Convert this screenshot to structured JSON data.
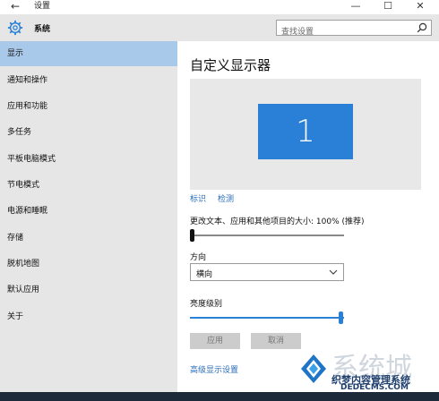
{
  "window": {
    "title": "设置",
    "back_icon": "arrow-left-icon",
    "controls": [
      "minimize-icon",
      "maximize-icon",
      "close-icon"
    ]
  },
  "sidebar": {
    "header": {
      "icon": "gear-icon",
      "label": "系统"
    },
    "items": [
      {
        "label": "显示",
        "active": true
      },
      {
        "label": "通知和操作"
      },
      {
        "label": "应用和功能"
      },
      {
        "label": "多任务"
      },
      {
        "label": "平板电脑模式"
      },
      {
        "label": "节电模式"
      },
      {
        "label": "电源和睡眠"
      },
      {
        "label": "存储"
      },
      {
        "label": "脱机地图"
      },
      {
        "label": "默认应用"
      },
      {
        "label": "关于"
      }
    ]
  },
  "search": {
    "placeholder": "查找设置",
    "icon": "search-icon"
  },
  "main": {
    "title": "自定义显示器",
    "monitor_number": "1",
    "links": {
      "identify": "标识",
      "detect": "检测"
    },
    "scale": {
      "label": "更改文本、应用和其他项目的大小: 100% (推荐)",
      "value_fraction": 0.0
    },
    "orientation": {
      "label": "方向",
      "value": "横向"
    },
    "brightness": {
      "label": "亮度级别",
      "value_fraction": 1.0
    },
    "buttons": {
      "apply": "应用",
      "cancel": "取消"
    },
    "advanced_link": "高级显示设置"
  },
  "watermark": {
    "text": "系统城",
    "site_cn": "织梦内容管理系统",
    "site_en": "DEDECMS.COM"
  },
  "colors": {
    "accent": "#2a80d6",
    "sidebar_bg": "#e6e6e6",
    "active_item": "#a9c9ea",
    "link": "#2a6db8"
  }
}
